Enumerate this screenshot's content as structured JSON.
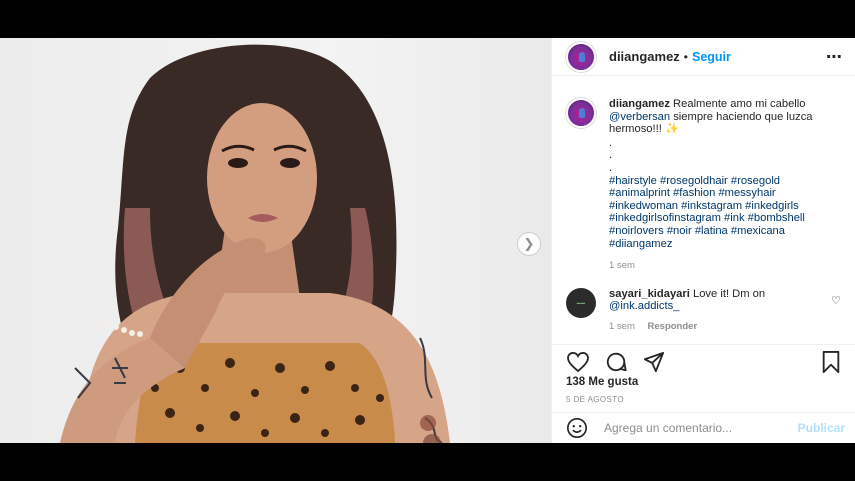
{
  "header": {
    "username": "diiangamez",
    "separator": "•",
    "follow_label": "Seguir",
    "more_icon": "⋯"
  },
  "caption": {
    "username": "diiangamez",
    "text_before": " Realmente amo mi cabello ",
    "emoji_placeholder": "",
    "mention": "@verbersan",
    "text_after": " siempre haciendo que luzca hermoso!!! ✨",
    "dots": [
      ".",
      ".",
      "."
    ],
    "hashtags": "#hairstyle #rosegoldhair #rosegold #animalprint #fashion #messyhair #inkedwoman #inkstagram #inkedgirls #inkedgirlsofinstagram #ink #bombshell #noirlovers #noir #latina #mexicana #diiangamez",
    "time": "1 sem"
  },
  "reply": {
    "username": "sayari_kidayari",
    "text": " Love it!",
    "emoji_placeholder": "",
    "text2": " Dm on ",
    "mention": "@ink.addicts_",
    "time": "1 sem",
    "reply_label": "Responder"
  },
  "likes": "138 Me gusta",
  "date": "5 DE AGOSTO",
  "comment_box": {
    "placeholder": "Agrega un comentario...",
    "post_label": "Publicar"
  },
  "icons": {
    "next": "chevron-right-icon",
    "like": "heart-icon",
    "comment": "comment-icon",
    "share": "paper-plane-icon",
    "save": "bookmark-icon",
    "emoji": "smiley-icon"
  },
  "colors": {
    "link": "#0095f6",
    "mention": "#00376b",
    "muted": "#8e8e8e",
    "post_disabled": "#b2dffc"
  }
}
